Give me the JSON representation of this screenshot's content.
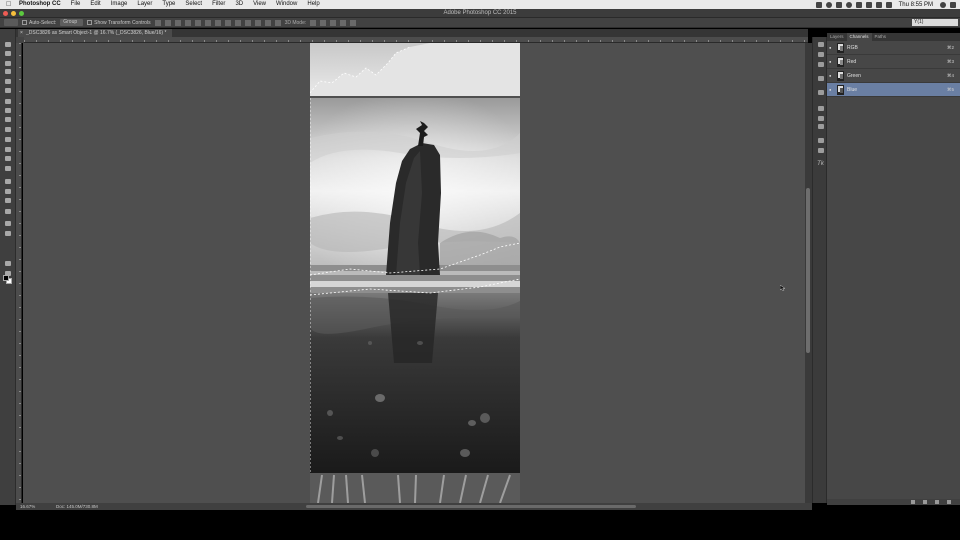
{
  "menubar": {
    "app_name": "Photoshop CC",
    "items": [
      "File",
      "Edit",
      "Image",
      "Layer",
      "Type",
      "Select",
      "Filter",
      "3D",
      "View",
      "Window",
      "Help"
    ],
    "clock": "Thu 8:55 PM"
  },
  "window": {
    "title": "Adobe Photoshop CC 2015"
  },
  "options_bar": {
    "auto_select_label": "Auto-Select:",
    "auto_select_value": "Group",
    "show_transform_label": "Show Transform Controls",
    "threed_label": "3D Mode:",
    "search_value": "Y(1)"
  },
  "document": {
    "tab_title": "_DSC3826 as Smart Object-1 @ 16.7% (_DSC3826, Blue/16) *",
    "zoom": "16.67%",
    "doc_size": "Doc: 145.0M/730.8M"
  },
  "panel": {
    "tabs": [
      "Layers",
      "Channels",
      "Paths"
    ],
    "active_tab": "Channels",
    "channels": [
      {
        "name": "RGB",
        "shortcut": "⌘2"
      },
      {
        "name": "Red",
        "shortcut": "⌘3"
      },
      {
        "name": "Green",
        "shortcut": "⌘4"
      },
      {
        "name": "Blue",
        "shortcut": "⌘5"
      }
    ],
    "selected_channel": "Blue"
  },
  "icons": {
    "toolbar": [
      "move-tool-icon",
      "marquee-tool-icon",
      "lasso-tool-icon",
      "quick-select-tool-icon",
      "crop-tool-icon",
      "eyedropper-tool-icon",
      "healing-brush-tool-icon",
      "brush-tool-icon",
      "clone-stamp-tool-icon",
      "history-brush-tool-icon",
      "eraser-tool-icon",
      "gradient-tool-icon",
      "blur-tool-icon",
      "dodge-tool-icon",
      "pen-tool-icon",
      "type-tool-icon",
      "path-select-tool-icon",
      "shape-tool-icon",
      "hand-tool-icon",
      "zoom-tool-icon"
    ],
    "panel_strip": [
      "layers-icon",
      "adjustments-icon",
      "history-icon",
      "actions-icon",
      "play-icon",
      "character-icon",
      "paragraph-icon",
      "styles-icon",
      "properties-icon",
      "info-icon",
      "glyphs-icon"
    ]
  },
  "colors": {
    "selected_row": "#6a7fa3",
    "canvas_bg": "#4f4f4f",
    "panel_bg": "#474747"
  }
}
